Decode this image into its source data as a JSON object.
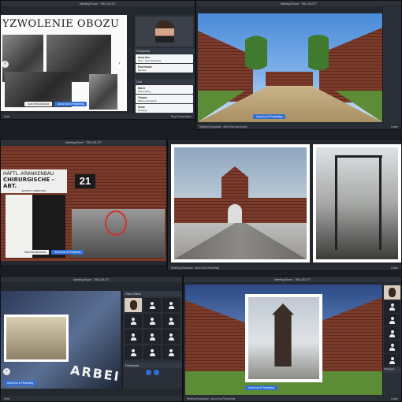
{
  "meetings": [
    {
      "id": "tl",
      "title": "Meeting Room · 785-125-377",
      "slide_heading": "YZWOLENIE OBOZU",
      "participants_label": "Participants",
      "participants": [
        {
          "name": "Anna Kos",
          "detail": "Host · Host Moderator"
        },
        {
          "name": "Ewa Nowak",
          "detail": "Member"
        }
      ],
      "chat_label": "Chat",
      "chat": [
        {
          "name": "Marek",
          "text": "Dzień dobry"
        },
        {
          "name": "Tomasz",
          "text": "Witam wszystkich"
        },
        {
          "name": "Kasia",
          "text": "Dziękuję"
        }
      ],
      "caption_left": "Sala Mieszkaniowa",
      "caption_btn": "Anna Kos is Presenting",
      "footer": "Leave",
      "status_left": "Mute",
      "status_right": "Stop Presentation"
    },
    {
      "id": "tr",
      "title": "Meeting Room · 785-125-377",
      "caption_btn": "Anna Kos is Presenting",
      "status_left": "Meeting Broadcast · Anna Kos has joined",
      "status_right": "Leave"
    },
    {
      "id": "ml",
      "title": "Meeting Room · 785-125-377",
      "sign_top": "HÄFTL.-KRANKENBAU",
      "sign_mid": "CHIRURGISCHE - ABT.",
      "sign_bot": "EINTRITT VERBOTEN",
      "block_num": "21",
      "caption_left": "Sala Mieszkaniowa",
      "caption_btn": "Anna Kos is Presenting"
    },
    {
      "id": "mr",
      "status_left": "Meeting Broadcast · Anna Kos Presenting",
      "status_right": "Leave"
    },
    {
      "id": "bl",
      "title": "Meeting Room · 785-125-377",
      "participants_label": "Guest Videos",
      "caption_btn": "Anna Kos is Presenting",
      "sign_text": "ARBEIT",
      "footer": "Participants",
      "status_left": "Mute"
    },
    {
      "id": "br",
      "title": "Meeting Room · 785-125-377",
      "participants_label": "Guest Videos",
      "caption_btn": "Anna Kos is Presenting",
      "status_left": "Meeting Broadcast · Anna Kos Presenting",
      "status_right": "Leave",
      "footer": "Participants"
    }
  ],
  "icons": [
    "chevron-left-icon",
    "chevron-right-icon",
    "user-icon",
    "microphone-icon",
    "camera-icon"
  ],
  "colors": {
    "accent": "#2f6fd6",
    "panel": "#23272e",
    "frame": "#2d323a"
  }
}
